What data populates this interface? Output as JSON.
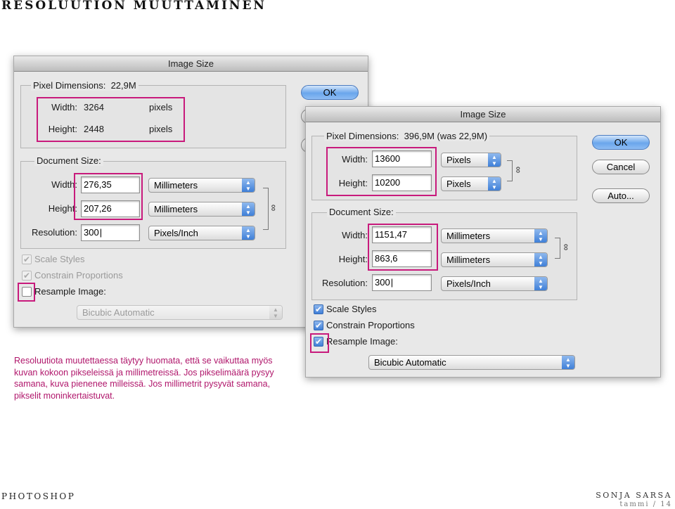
{
  "page": {
    "title": "RESOLUUTION MUUTTAMINEN",
    "caption": "Resoluutiota muutettaessa täytyy huomata, että se vaikuttaa myös kuvan kokoon pikseleissä ja millimetreissä. Jos pikselimäärä pysyy samana, kuva pienenee milleissä. Jos millimetrit pysyvät samana, pikselit moninkertaistuvat.",
    "footer_left": "PHOTOSHOP",
    "footer_author": "SONJA SARSA",
    "footer_page": "tammi / 14"
  },
  "dialog1": {
    "title": "Image Size",
    "pixel_dimensions_label": "Pixel Dimensions:",
    "pixel_dimensions_value": "22,9M",
    "px_width_label": "Width:",
    "px_width_value": "3264",
    "px_width_unit": "pixels",
    "px_height_label": "Height:",
    "px_height_value": "2448",
    "px_height_unit": "pixels",
    "document_size_label": "Document Size:",
    "doc_width_label": "Width:",
    "doc_width_value": "276,35",
    "doc_width_unit": "Millimeters",
    "doc_height_label": "Height:",
    "doc_height_value": "207,26",
    "doc_height_unit": "Millimeters",
    "resolution_label": "Resolution:",
    "resolution_value": "300",
    "resolution_unit": "Pixels/Inch",
    "scale_styles": "Scale Styles",
    "constrain_proportions": "Constrain Proportions",
    "resample_image": "Resample Image:",
    "resample_method": "Bicubic Automatic",
    "ok": "OK"
  },
  "dialog2": {
    "title": "Image Size",
    "pixel_dimensions_label": "Pixel Dimensions:",
    "pixel_dimensions_value": "396,9M (was 22,9M)",
    "px_width_label": "Width:",
    "px_width_value": "13600",
    "px_width_unit": "Pixels",
    "px_height_label": "Height:",
    "px_height_value": "10200",
    "px_height_unit": "Pixels",
    "document_size_label": "Document Size:",
    "doc_width_label": "Width:",
    "doc_width_value": "1151,47",
    "doc_width_unit": "Millimeters",
    "doc_height_label": "Height:",
    "doc_height_value": "863,6",
    "doc_height_unit": "Millimeters",
    "resolution_label": "Resolution:",
    "resolution_value": "300",
    "resolution_unit": "Pixels/Inch",
    "scale_styles": "Scale Styles",
    "constrain_proportions": "Constrain Proportions",
    "resample_image": "Resample Image:",
    "resample_method": "Bicubic Automatic",
    "ok": "OK",
    "cancel": "Cancel",
    "auto": "Auto..."
  },
  "icons": {
    "checkmark": "✔",
    "dropdown": "▲▼",
    "link": "chain-link-icon"
  },
  "colors": {
    "highlight": "#c81a7c",
    "caption": "#b0166b",
    "button_blue": "#3f7fd8"
  }
}
